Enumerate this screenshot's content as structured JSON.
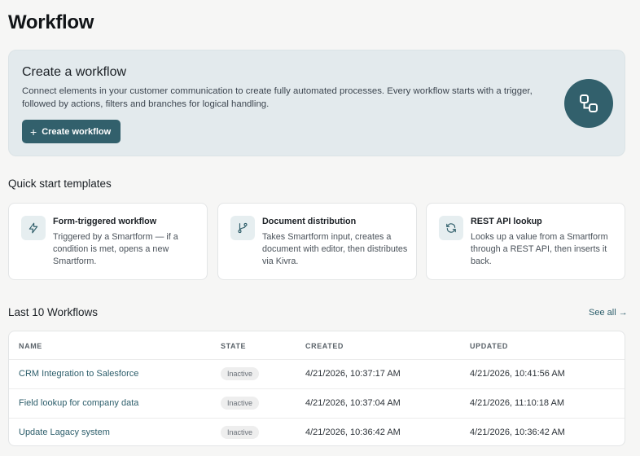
{
  "page": {
    "title": "Workflow"
  },
  "hero": {
    "title": "Create a workflow",
    "description": "Connect elements in your customer communication to create fully automated processes. Every workflow starts with a trigger, followed by actions, filters and branches for logical handling.",
    "button_label": "Create workflow",
    "icon": "workflow-nodes-icon",
    "accent_color": "#32606c"
  },
  "templates": {
    "title": "Quick start templates",
    "items": [
      {
        "title": "Form-triggered workflow",
        "description": "Triggered by a Smartform — if a condition is met, opens a new Smartform.",
        "icon": "lightning-icon"
      },
      {
        "title": "Document distribution",
        "description": "Takes Smartform input, creates a document with editor, then distributes via Kivra.",
        "icon": "branch-icon"
      },
      {
        "title": "REST API lookup",
        "description": "Looks up a value from a Smartform through a REST API, then inserts it back.",
        "icon": "refresh-icon"
      }
    ]
  },
  "workflows": {
    "title": "Last 10 Workflows",
    "see_all": "See all →",
    "columns": [
      "NAME",
      "STATE",
      "CREATED",
      "UPDATED"
    ],
    "rows": [
      {
        "name": "CRM Integration to Salesforce",
        "state": "Inactive",
        "created": "4/21/2026, 10:37:17 AM",
        "updated": "4/21/2026, 10:41:56 AM"
      },
      {
        "name": "Field lookup for company data",
        "state": "Inactive",
        "created": "4/21/2026, 10:37:04 AM",
        "updated": "4/21/2026, 11:10:18 AM"
      },
      {
        "name": "Update Lagacy system",
        "state": "Inactive",
        "created": "4/21/2026, 10:36:42 AM",
        "updated": "4/21/2026, 10:36:42 AM"
      }
    ]
  }
}
